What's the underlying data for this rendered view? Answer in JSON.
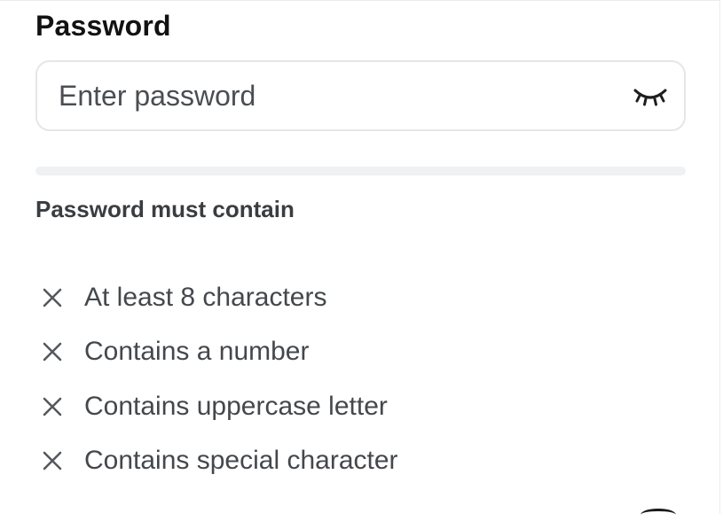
{
  "password": {
    "label": "Password",
    "placeholder": "Enter password",
    "value": "",
    "toggle_icon": "eye-closed-icon"
  },
  "strength": {
    "level": 0
  },
  "requirements": {
    "heading": "Password must contain",
    "status_icon": "x-icon",
    "items": [
      {
        "label": "At least 8 characters",
        "met": false
      },
      {
        "label": "Contains a number",
        "met": false
      },
      {
        "label": "Contains uppercase letter",
        "met": false
      },
      {
        "label": "Contains special character",
        "met": false
      }
    ]
  },
  "colors": {
    "label": "#121212",
    "input_border": "#e6e6e6",
    "placeholder": "#4a4e52",
    "requirement_text": "#44484c",
    "strength_track": "#f0f1f2"
  }
}
